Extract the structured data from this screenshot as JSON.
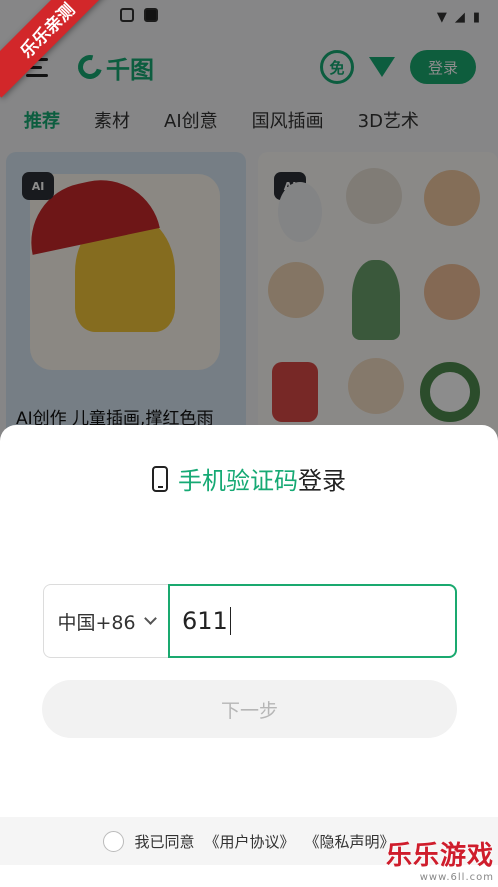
{
  "status_bar": {
    "left": "",
    "right_icons": [
      "wifi-icon",
      "signal-icon",
      "battery-icon"
    ]
  },
  "header": {
    "logo": "千图",
    "free_badge": "免",
    "login_label": "登录"
  },
  "tabs": [
    "推荐",
    "素材",
    "AI创意",
    "国风插画",
    "3D艺术"
  ],
  "cards": [
    {
      "badge": "AI",
      "caption": "AI创作 儿童插画,撑红色雨"
    },
    {
      "badge": "AI",
      "caption": ""
    }
  ],
  "login_sheet": {
    "title_green": "手机验证码",
    "title_dark": "登录",
    "country_code": "中国+86",
    "phone_value": "611",
    "next_label": "下一步",
    "agree_text": "我已同意",
    "user_agreement": "《用户协议》",
    "privacy_policy": "《隐私声明》"
  },
  "watermark": {
    "ribbon": "乐乐亲测",
    "brand": "乐乐游戏",
    "url": "www.6ll.com"
  },
  "colors": {
    "accent": "#1aa96f",
    "ribbon": "#d2272a"
  }
}
